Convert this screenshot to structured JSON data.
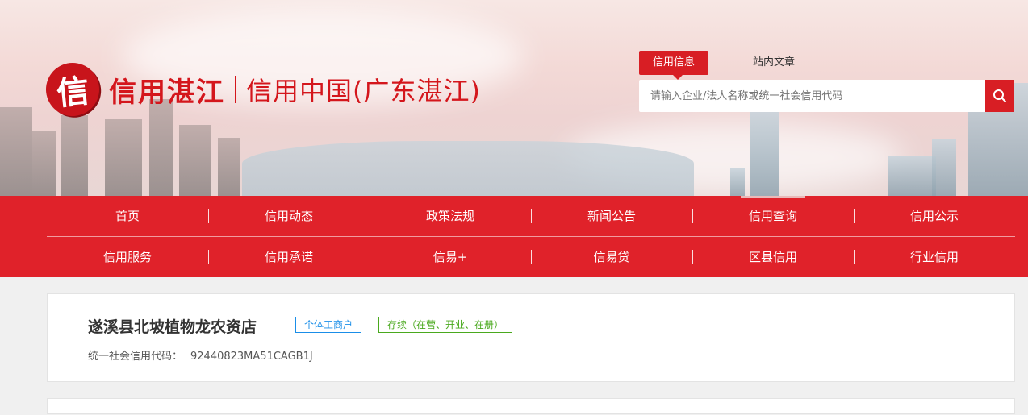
{
  "header": {
    "logo_seal": "信",
    "logo_title": "信用湛江",
    "logo_subtitle": "信用中国(广东湛江)"
  },
  "search": {
    "tabs": [
      {
        "label": "信用信息",
        "active": true
      },
      {
        "label": "站内文章",
        "active": false
      }
    ],
    "placeholder": "请输入企业/法人名称或统一社会信用代码",
    "button_icon": "search-icon"
  },
  "nav": {
    "row1": [
      {
        "label": "首页"
      },
      {
        "label": "信用动态"
      },
      {
        "label": "政策法规"
      },
      {
        "label": "新闻公告"
      },
      {
        "label": "信用查询",
        "current": true
      },
      {
        "label": "信用公示"
      }
    ],
    "row2": [
      {
        "label": "信用服务"
      },
      {
        "label": "信用承诺"
      },
      {
        "label": "信易+"
      },
      {
        "label": "信易贷"
      },
      {
        "label": "区县信用"
      },
      {
        "label": "行业信用"
      }
    ]
  },
  "company": {
    "name": "遂溪县北坡植物龙农资店",
    "type_tag": "个体工商户",
    "status_tag": "存续（在营、开业、在册）",
    "credit_code_label": "统一社会信用代码：",
    "credit_code_value": "92440823MA51CAGB1J"
  },
  "colors": {
    "brand_red": "#e0222a",
    "type_tag": "#1a8ee8",
    "status_tag": "#4aa91e"
  }
}
